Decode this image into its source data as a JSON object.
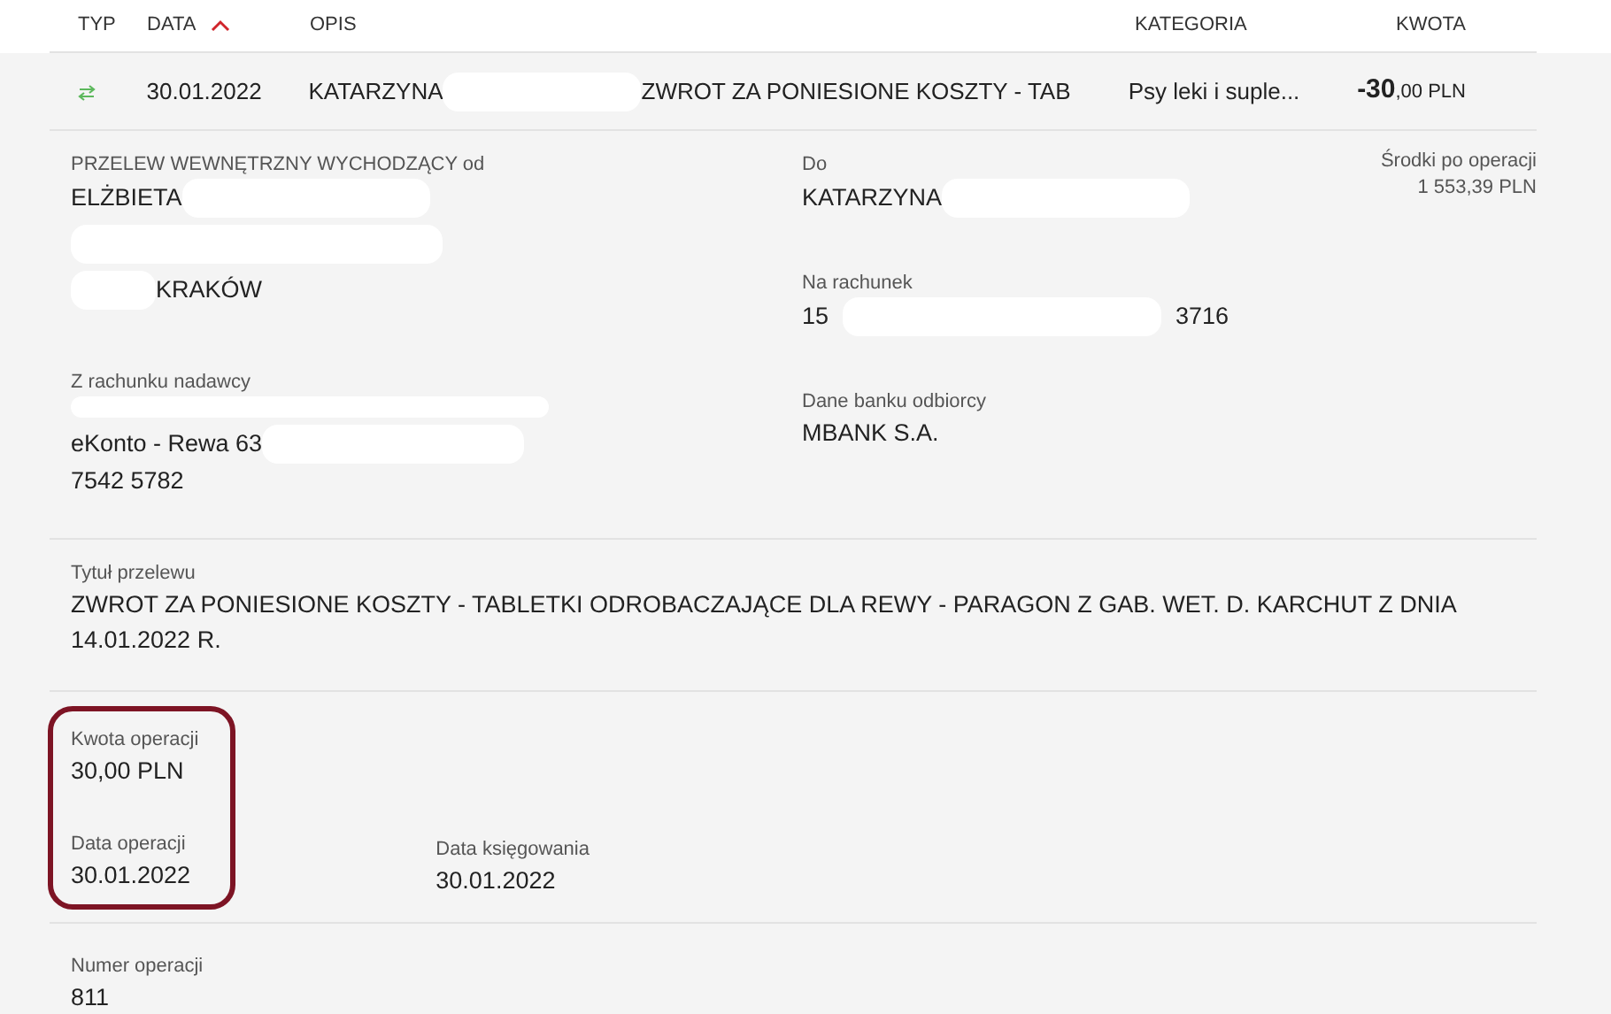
{
  "columns": [
    {
      "label": "TYP",
      "sorted": false
    },
    {
      "label": "DATA",
      "sorted": true
    },
    {
      "label": "OPIS",
      "sorted": false
    },
    {
      "label": "KATEGORIA",
      "sorted": false
    },
    {
      "label": "KWOTA",
      "sorted": false
    }
  ],
  "row": {
    "date": "30.01.2022",
    "description_start": "KATARZYNA",
    "description_end": "ZWROT ZA PONIESIONE KOSZTY - TAB",
    "category": "Psy leki i suple...",
    "amount_whole": "-30",
    "amount_rest": ",00 PLN"
  },
  "sender": {
    "label": "PRZELEW WEWNĘTRZNY WYCHODZĄCY od",
    "name": "ELŻBIETA",
    "city": "KRAKÓW"
  },
  "source_account": {
    "label": "Z rachunku nadawcy",
    "name": "eKonto - Rewa 63",
    "number": "7542 5782"
  },
  "recipient": {
    "label": "Do",
    "name": "KATARZYNA"
  },
  "target_account": {
    "label": "Na rachunek",
    "start": "15",
    "end": "3716"
  },
  "bank": {
    "label": "Dane banku odbiorcy",
    "value": "MBANK S.A."
  },
  "balance": {
    "label": "Środki po operacji",
    "value": "1 553,39 PLN"
  },
  "title": {
    "label": "Tytuł przelewu",
    "value": "ZWROT ZA PONIESIONE KOSZTY - TABLETKI ODROBACZAJĄCE DLA REWY - PARAGON Z GAB. WET. D. KARCHUT Z DNIA 14.01.2022 R."
  },
  "amount": {
    "label": "Kwota operacji",
    "value": "30,00 PLN",
    "framed": true
  },
  "operation_date": {
    "label": "Data operacji",
    "value": "30.01.2022"
  },
  "booking_date": {
    "label": "Data księgowania",
    "value": "30.01.2022"
  },
  "operation_number": {
    "label": "Numer operacji",
    "value": "811"
  }
}
